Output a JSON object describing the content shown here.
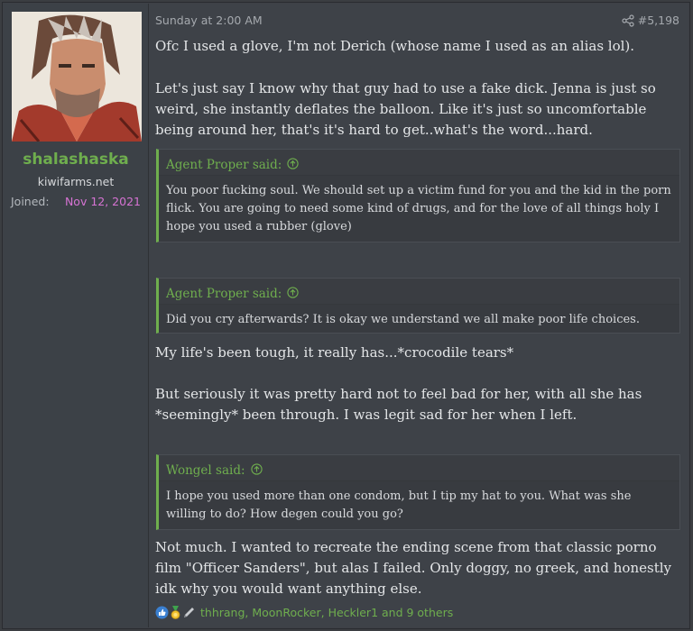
{
  "user": {
    "username": "shalashaska",
    "user_title": "kiwifarms.net",
    "joined_label": "Joined:",
    "joined_date": "Nov 12, 2021"
  },
  "post": {
    "date": "Sunday at 2:00 AM",
    "number": "#5,198",
    "paragraphs": [
      "Ofc I used a glove, I'm not Derich (whose name I used as an alias lol).",
      "Let's just say I know why that guy had to use a fake dick. Jenna is just so weird, she instantly deflates the balloon. Like it's just so uncomfortable being around her, that's it's hard to get..what's the word...hard.",
      "My life's been tough, it really has...*crocodile tears*",
      "But seriously it was pretty hard not to feel bad for her, with all she has *seemingly* been through. I was legit sad for her when I left.",
      "Not much. I wanted to recreate the ending scene from that classic porno film \"Officer Sanders\", but alas I failed. Only doggy, no greek, and honestly idk why you would want anything else."
    ],
    "quotes": [
      {
        "author": "Agent Proper said:",
        "text": "You poor fucking soul. We should set up a victim fund for you and the kid in the porn flick. You are going to need some kind of drugs, and for the love of all things holy I hope you used a rubber (glove)"
      },
      {
        "author": "Agent Proper said:",
        "text": "Did you cry afterwards? It is okay we understand we all make poor life choices."
      },
      {
        "author": "Wongel said:",
        "text": "I hope you used more than one condom, but I tip my hat to you. What was she willing to do? How degen could you go?"
      }
    ],
    "reactions": {
      "icons": [
        "like-icon",
        "winner-medal-icon",
        "pencil-icon"
      ],
      "text": "thhrang, MoonRocker, Heckler1 and 9 others"
    }
  },
  "colors": {
    "accent_green": "#6fae4e",
    "joined_date_pink": "#d673d3",
    "background": "#3e4248"
  }
}
